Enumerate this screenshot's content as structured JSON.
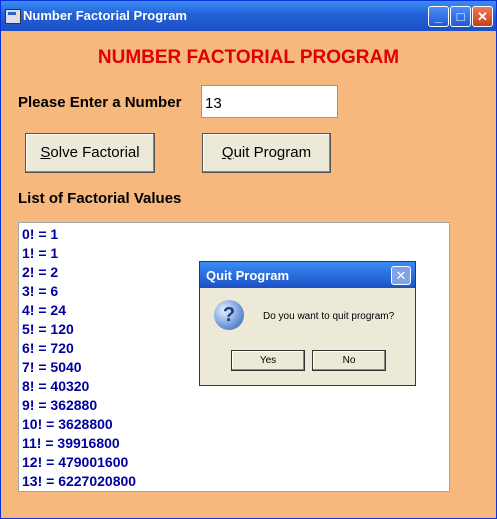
{
  "window": {
    "title": "Number Factorial Program",
    "controls": {
      "minimize": "_",
      "maximize": "□",
      "close": "✕"
    }
  },
  "heading": "NUMBER FACTORIAL PROGRAM",
  "prompt_label": "Please Enter a Number",
  "number_input_value": "13",
  "solve_button": {
    "mnemonic": "S",
    "rest": "olve Factorial"
  },
  "quit_button": {
    "mnemonic": "Q",
    "rest": "uit Program"
  },
  "list_label": "List of Factorial Values",
  "factorials": [
    "0! = 1",
    "1! = 1",
    "2! = 2",
    "3! = 6",
    "4! = 24",
    "5! = 120",
    "6! = 720",
    "7! = 5040",
    "8! = 40320",
    "9! = 362880",
    "10! = 3628800",
    "11! = 39916800",
    "12! = 479001600",
    "13! = 6227020800"
  ],
  "dialog": {
    "title": "Quit Program",
    "close": "✕",
    "icon": "question-icon",
    "message": "Do you want to quit program?",
    "yes_label": "Yes",
    "no_label": "No"
  },
  "colors": {
    "window_background": "#f6b87d",
    "heading": "#e00000",
    "list_text": "#0000a0",
    "titlebar": "#2361d6"
  }
}
